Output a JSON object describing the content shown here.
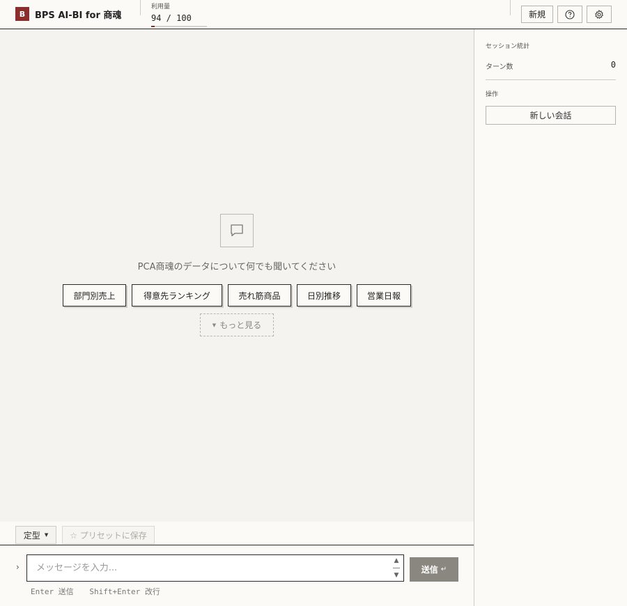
{
  "header": {
    "logo_letter": "B",
    "app_title": "BPS AI-BI for 商魂",
    "usage_label": "利用量",
    "usage_text": "94 / 100",
    "usage_fraction": 0.06,
    "new_label": "新規",
    "help_icon": "help-circle-icon",
    "settings_icon": "gear-icon"
  },
  "empty_state": {
    "icon": "chat-bubble-icon",
    "prompt": "PCA商魂のデータについて何でも聞いてください",
    "chips": [
      "部門別売上",
      "得意先ランキング",
      "売れ筋商品",
      "日別推移",
      "営業日報"
    ],
    "more_label": "もっと見る"
  },
  "preset_bar": {
    "template_label": "定型",
    "save_preset_label": "☆ プリセットに保存"
  },
  "composer": {
    "placeholder": "メッセージを入力...",
    "send_label": "送信",
    "send_glyph": "↵",
    "hint_send": "Enter 送信",
    "hint_newline": "Shift+Enter 改行"
  },
  "side_panel": {
    "session_stats_title": "セッション統計",
    "turns_label": "ターン数",
    "turns_value": "0",
    "operations_title": "操作",
    "new_session_label": "新しい会話"
  },
  "colors": {
    "brand": "#8a2d2d",
    "send_button": "#8a8781"
  }
}
